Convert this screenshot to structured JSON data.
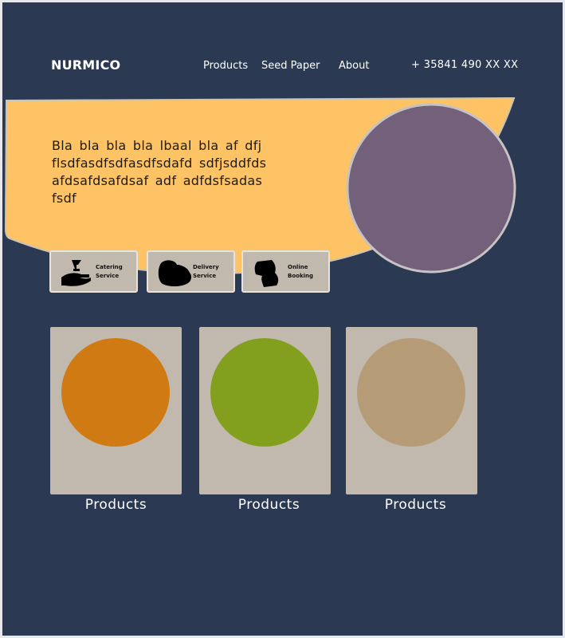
{
  "header": {
    "brand": "NURMICO",
    "nav": {
      "products": "Products",
      "seed_paper": "Seed Paper",
      "about": "About"
    },
    "phone": "+ 35841 490 XX XX"
  },
  "hero": {
    "text": "Bla bla bla bla lbaal bla af dfj flsdfasdfsdfasdfsdafd sdfjsddfdsafdsafdsafdsaf adf adfdsfsadasfsdf",
    "banner_color": "#fdc364",
    "circle_color": "#73607a"
  },
  "services": [
    {
      "label_line1": "Catering",
      "label_line2": "Service",
      "icon": "serving-hand-icon"
    },
    {
      "label_line1": "Delivery",
      "label_line2": "Service",
      "icon": "cloud-blob-icon"
    },
    {
      "label_line1": "Online",
      "label_line2": "Booking",
      "icon": "puzzle-blob-icon"
    }
  ],
  "products": [
    {
      "caption": "Products",
      "color": "#d07a14"
    },
    {
      "caption": "Products",
      "color": "#82a01e"
    },
    {
      "caption": "Products",
      "color": "#b59b76"
    }
  ],
  "colors": {
    "background": "#2b3a52",
    "card": "#c2b9ae"
  }
}
